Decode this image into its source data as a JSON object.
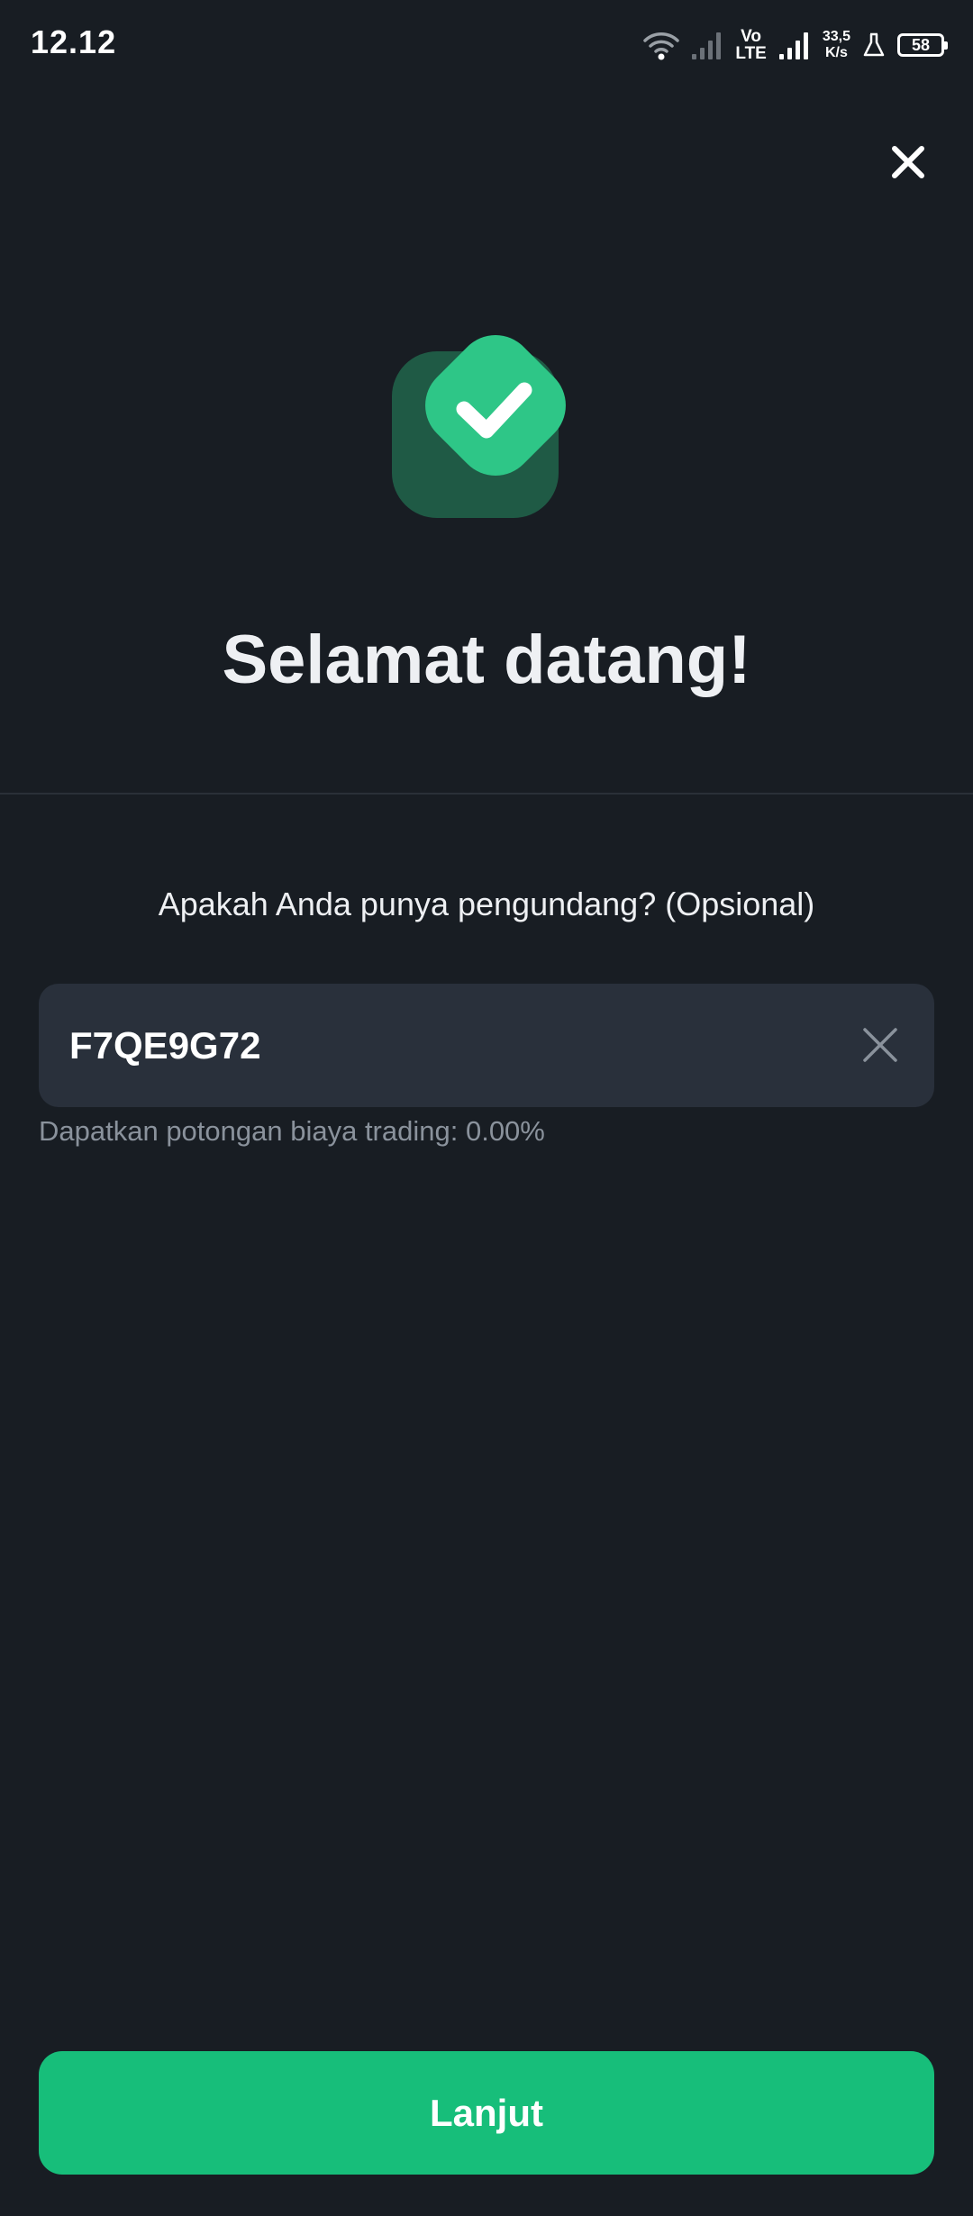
{
  "status_bar": {
    "time": "12.12",
    "network_top": "Vo",
    "network_bottom": "LTE",
    "speed_value": "33,5",
    "speed_unit": "K/s",
    "battery": "58",
    "icons": [
      "wifi-icon",
      "signal-icon",
      "signal-icon",
      "flask-icon",
      "battery-icon"
    ]
  },
  "header": {
    "close_icon": "close-icon"
  },
  "hero": {
    "icon": "success-check-icon",
    "title": "Selamat datang!"
  },
  "referral": {
    "question": "Apakah Anda punya pengundang? (Opsional)",
    "code_value": "F7QE9G72",
    "clear_icon": "clear-icon",
    "hint": "Dapatkan potongan biaya trading: 0.00%"
  },
  "footer": {
    "continue_label": "Lanjut"
  },
  "colors": {
    "background": "#181d23",
    "accent_green": "#17be7a",
    "field_background": "#29303b",
    "hint_text": "#8a929c"
  }
}
